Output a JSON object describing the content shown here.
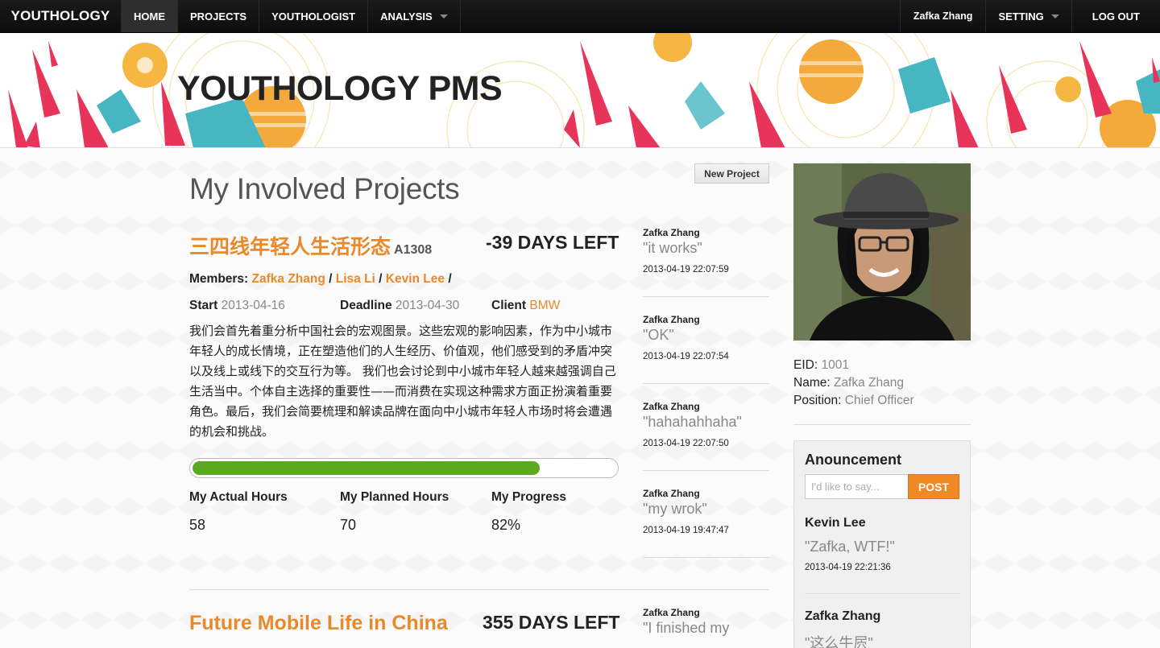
{
  "nav": {
    "brand": "YOUTHOLOGY",
    "items": [
      {
        "label": "HOME"
      },
      {
        "label": "PROJECTS"
      },
      {
        "label": "YOUTHOLOGIST"
      },
      {
        "label": "ANALYSIS"
      }
    ],
    "user": "Zafka Zhang",
    "setting": "SETTING",
    "logout": "LOG OUT"
  },
  "banner": {
    "title": "YOUTHOLOGY PMS"
  },
  "main": {
    "title": "My Involved Projects",
    "new_project": "New Project"
  },
  "projects": [
    {
      "title": "三四线年轻人生活形态",
      "code": "A1308",
      "days_left": "-39 DAYS LEFT",
      "members_label": "Members:",
      "members": [
        "Zafka Zhang",
        "Lisa Li",
        "Kevin Lee"
      ],
      "start_label": "Start",
      "start": "2013-04-16",
      "deadline_label": "Deadline",
      "deadline": "2013-04-30",
      "client_label": "Client",
      "client": "BMW",
      "description": "我们会首先着重分析中国社会的宏观图景。这些宏观的影响因素，作为中小城市年轻人的成长情境，正在塑造他们的人生经历、价值观，他们感受到的矛盾冲突以及线上或线下的交互行为等。 我们也会讨论到中小城市年轻人越来越强调自己生活当中。个体自主选择的重要性——而消费在实现这种需求方面正扮演着重要角色。最后，我们会简要梳理和解读品牌在面向中小城市年轻人市场时将会遭遇的机会和挑战。",
      "progress": 0.82,
      "actual_hours_label": "My Actual Hours",
      "actual_hours": "58",
      "planned_hours_label": "My Planned Hours",
      "planned_hours": "70",
      "progress_label": "My Progress",
      "progress_text": "82%",
      "comments": [
        {
          "author": "Zafka Zhang",
          "text": "\"it works\"",
          "time": "2013-04-19 22:07:59"
        },
        {
          "author": "Zafka Zhang",
          "text": "\"OK\"",
          "time": "2013-04-19 22:07:54"
        },
        {
          "author": "Zafka Zhang",
          "text": "\"hahahahhaha\"",
          "time": "2013-04-19 22:07:50"
        },
        {
          "author": "Zafka Zhang",
          "text": "\"my wrok\"",
          "time": "2013-04-19 19:47:47"
        }
      ]
    },
    {
      "title": "Future Mobile Life in China",
      "days_left": "355 DAYS LEFT",
      "comments": [
        {
          "author": "Zafka Zhang",
          "text": "\"I finished my"
        }
      ]
    }
  ],
  "profile": {
    "eid_label": "EID:",
    "eid": "1001",
    "name_label": "Name:",
    "name": "Zafka Zhang",
    "position_label": "Position:",
    "position": "Chief Officer"
  },
  "announcement": {
    "title": "Anouncement",
    "placeholder": "I'd like to say...",
    "post": "POST",
    "items": [
      {
        "author": "Kevin Lee",
        "text": "\"Zafka, WTF!\"",
        "time": "2013-04-19 22:21:36"
      },
      {
        "author": "Zafka Zhang",
        "text": "\"这么牛屄\""
      }
    ]
  },
  "colors": {
    "accent": "#e8892b",
    "progress": "#5aa91f",
    "post_button": "#ef8a24"
  }
}
